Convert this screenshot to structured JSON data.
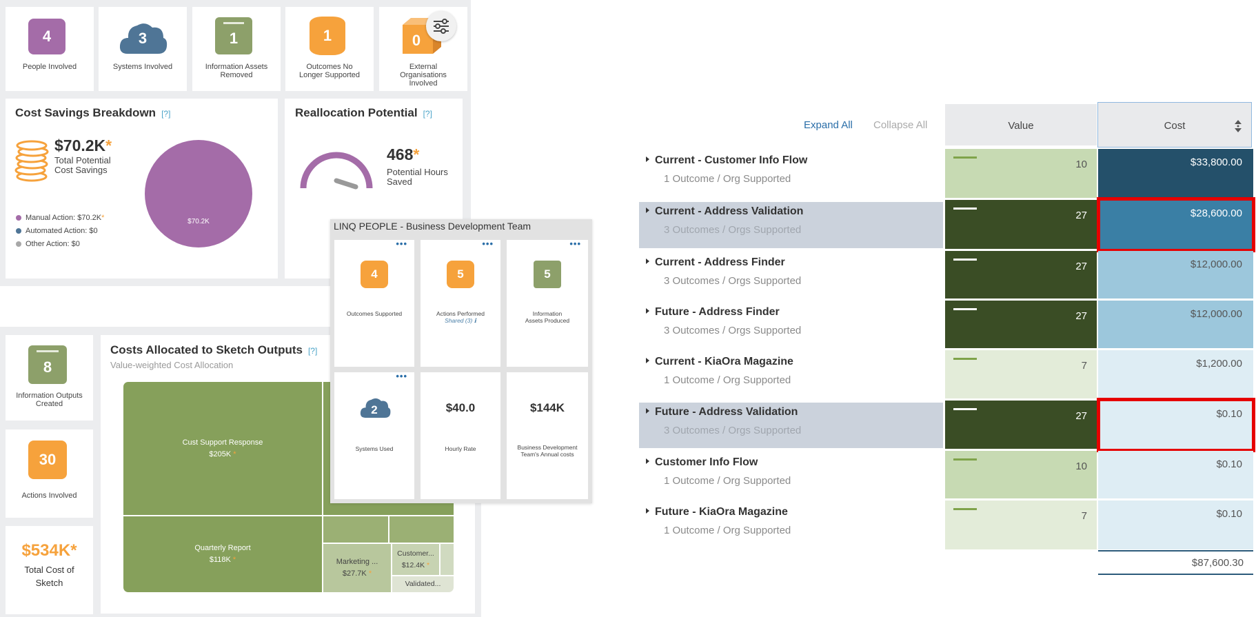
{
  "kpis": [
    {
      "value": "4",
      "label": "People Involved",
      "color": "#a46ca8",
      "icon": "square-badge"
    },
    {
      "value": "3",
      "label": "Systems Involved",
      "color": "#4f7596",
      "icon": "cloud-icon"
    },
    {
      "value": "1",
      "label": "Information Assets Removed",
      "color": "#8da06a",
      "icon": "document-icon"
    },
    {
      "value": "1",
      "label": "Outcomes No Longer Supported",
      "color": "#f6a23c",
      "icon": "barrel-icon"
    },
    {
      "value": "0",
      "label": "External Organisations Involved",
      "color": "#f6a23c",
      "icon": "box-icon"
    }
  ],
  "filter_icon": "sliders-icon",
  "cost_savings": {
    "title": "Cost Savings Breakdown",
    "help": "[?]",
    "amount": "$70.2K",
    "star": "*",
    "caption": "Total Potential Cost Savings",
    "pie_label": "$70.2K",
    "pie_color": "#a46ca8",
    "legend": [
      {
        "text": "Manual Action: $70.2K",
        "star": "*",
        "color": "#a46ca8"
      },
      {
        "text": "Automated Action: $0",
        "star": "",
        "color": "#4f7596"
      },
      {
        "text": "Other Action: $0",
        "star": "",
        "color": "#a8a8a8"
      }
    ]
  },
  "reallocation": {
    "title": "Reallocation Potential",
    "help": "[?]",
    "value": "468",
    "star": "*",
    "caption": "Potential Hours Saved"
  },
  "left_kpis": [
    {
      "value": "8",
      "label": "Information Outputs Created",
      "color": "#8da06a"
    },
    {
      "value": "30",
      "label": "Actions Involved",
      "color": "#f6a23c"
    }
  ],
  "total_cost": {
    "value": "$534K",
    "star": "*",
    "label": "Total Cost of Sketch"
  },
  "costs_allocated": {
    "title": "Costs Allocated to Sketch Outputs",
    "help": "[?]",
    "subtitle": "Value-weighted Cost Allocation",
    "tiles": [
      {
        "name": "Cust Support Response",
        "value": "$205K"
      },
      {
        "name": "Quarterly Report",
        "value": "$118K"
      },
      {
        "name": "Marketing ...",
        "value": "$27.7K"
      },
      {
        "name": "Customer...",
        "value": "$12.4K"
      },
      {
        "name": "Validated...",
        "value": ""
      }
    ]
  },
  "people_popup": {
    "title": "LINQ PEOPLE - Business Development Team",
    "cards": [
      {
        "value": "4",
        "label": "Outcomes Supported",
        "sub": "",
        "color": "#f6a23c"
      },
      {
        "value": "5",
        "label": "Actions Performed",
        "sub": "Shared (3)",
        "color": "#f6a23c"
      },
      {
        "value": "5",
        "label": "Information Assets Produced",
        "sub": "",
        "color": "#8da06a"
      },
      {
        "value": "2",
        "label": "Systems Used",
        "sub": "",
        "color": "#4f7596"
      },
      {
        "value": "$40.0",
        "label": "Hourly Rate",
        "sub": "",
        "color": ""
      },
      {
        "value": "$144K",
        "label": "Business Development Team's Annual costs",
        "sub": "",
        "color": ""
      }
    ]
  },
  "table": {
    "expand_all": "Expand All",
    "collapse_all": "Collapse All",
    "col_value": "Value",
    "col_cost": "Cost",
    "rows": [
      {
        "title": "Current - Customer Info Flow",
        "sub": "1 Outcome / Org Supported",
        "value": "10",
        "cost": "$33,800.00",
        "value_color": "#c7dab3",
        "cost_color": "#24506a",
        "selected": false
      },
      {
        "title": "Current - Address Validation",
        "sub": "3 Outcomes / Orgs Supported",
        "value": "27",
        "cost": "$28,600.00",
        "value_color": "#3a4d25",
        "cost_color": "#3a7fa5",
        "selected": true
      },
      {
        "title": "Current - Address Finder",
        "sub": "3 Outcomes / Orgs Supported",
        "value": "27",
        "cost": "$12,000.00",
        "value_color": "#3a4d25",
        "cost_color": "#9cc7dc",
        "selected": false
      },
      {
        "title": "Future - Address Finder",
        "sub": "3 Outcomes / Orgs Supported",
        "value": "27",
        "cost": "$12,000.00",
        "value_color": "#3a4d25",
        "cost_color": "#9cc7dc",
        "selected": false
      },
      {
        "title": "Current - KiaOra Magazine",
        "sub": "1 Outcome / Org Supported",
        "value": "7",
        "cost": "$1,200.00",
        "value_color": "#e3ecd9",
        "cost_color": "#deedf4",
        "selected": false
      },
      {
        "title": "Future - Address Validation",
        "sub": "3 Outcomes / Orgs Supported",
        "value": "27",
        "cost": "$0.10",
        "value_color": "#3a4d25",
        "cost_color": "#deedf4",
        "selected": true
      },
      {
        "title": "Customer Info Flow",
        "sub": "1 Outcome / Org Supported",
        "value": "10",
        "cost": "$0.10",
        "value_color": "#c7dab3",
        "cost_color": "#deedf4",
        "selected": false
      },
      {
        "title": "Future - KiaOra Magazine",
        "sub": "1 Outcome / Org Supported",
        "value": "7",
        "cost": "$0.10",
        "value_color": "#e3ecd9",
        "cost_color": "#deedf4",
        "selected": false
      }
    ],
    "total": "$87,600.30",
    "highlight_color": "#e60000"
  }
}
